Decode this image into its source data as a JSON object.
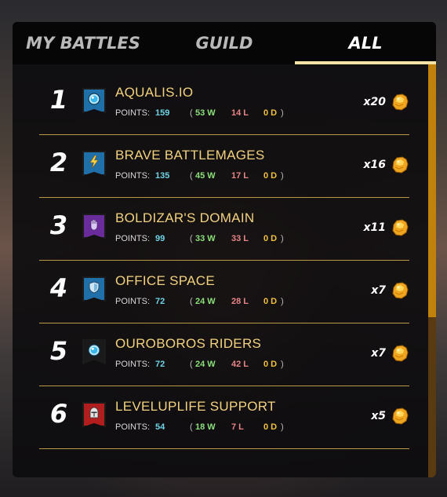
{
  "tabs": [
    {
      "label": "MY BATTLES"
    },
    {
      "label": "GUILD"
    },
    {
      "label": "ALL"
    }
  ],
  "active_tab": "ALL",
  "points_label": "POINTS:",
  "open_paren": "(",
  "close_paren": ")",
  "rows": [
    {
      "rank": "1",
      "name": "AQUALIS.IO",
      "points": "159",
      "wins": "53 W",
      "losses": "14 L",
      "draws": "0 D",
      "multiplier": "x20",
      "banner_color": "#1f6fa8",
      "emblem": "orb-icon"
    },
    {
      "rank": "2",
      "name": "BRAVE BATTLEMAGES",
      "points": "135",
      "wins": "45 W",
      "losses": "17 L",
      "draws": "0 D",
      "multiplier": "x16",
      "banner_color": "#1f6fa8",
      "emblem": "lightning-icon"
    },
    {
      "rank": "3",
      "name": "BOLDIZAR'S DOMAIN",
      "points": "99",
      "wins": "33 W",
      "losses": "33 L",
      "draws": "0 D",
      "multiplier": "x11",
      "banner_color": "#6a2c9a",
      "emblem": "hand-icon"
    },
    {
      "rank": "4",
      "name": "OFFICE SPACE",
      "points": "72",
      "wins": "24 W",
      "losses": "28 L",
      "draws": "0 D",
      "multiplier": "x7",
      "banner_color": "#1f6fa8",
      "emblem": "shield-icon"
    },
    {
      "rank": "5",
      "name": "OUROBOROS RIDERS",
      "points": "72",
      "wins": "24 W",
      "losses": "42 L",
      "draws": "0 D",
      "multiplier": "x7",
      "banner_color": "#1a1a1a",
      "emblem": "orb-icon"
    },
    {
      "rank": "6",
      "name": "LEVELUPLIFE SUPPORT",
      "points": "54",
      "wins": "18 W",
      "losses": "7 L",
      "draws": "0 D",
      "multiplier": "x5",
      "banner_color": "#b21e1e",
      "emblem": "knight-helmet-icon"
    }
  ],
  "reward_icon": "gold-nugget-icon",
  "colors": {
    "guild_name": "#f2d27e",
    "points_value": "#6fd4e6",
    "wins": "#8be07a",
    "losses": "#e88587",
    "draws": "#f0c23c",
    "active_tab_underline": "#f3e3a6",
    "scrollbar_thumb": "#c1810d"
  }
}
